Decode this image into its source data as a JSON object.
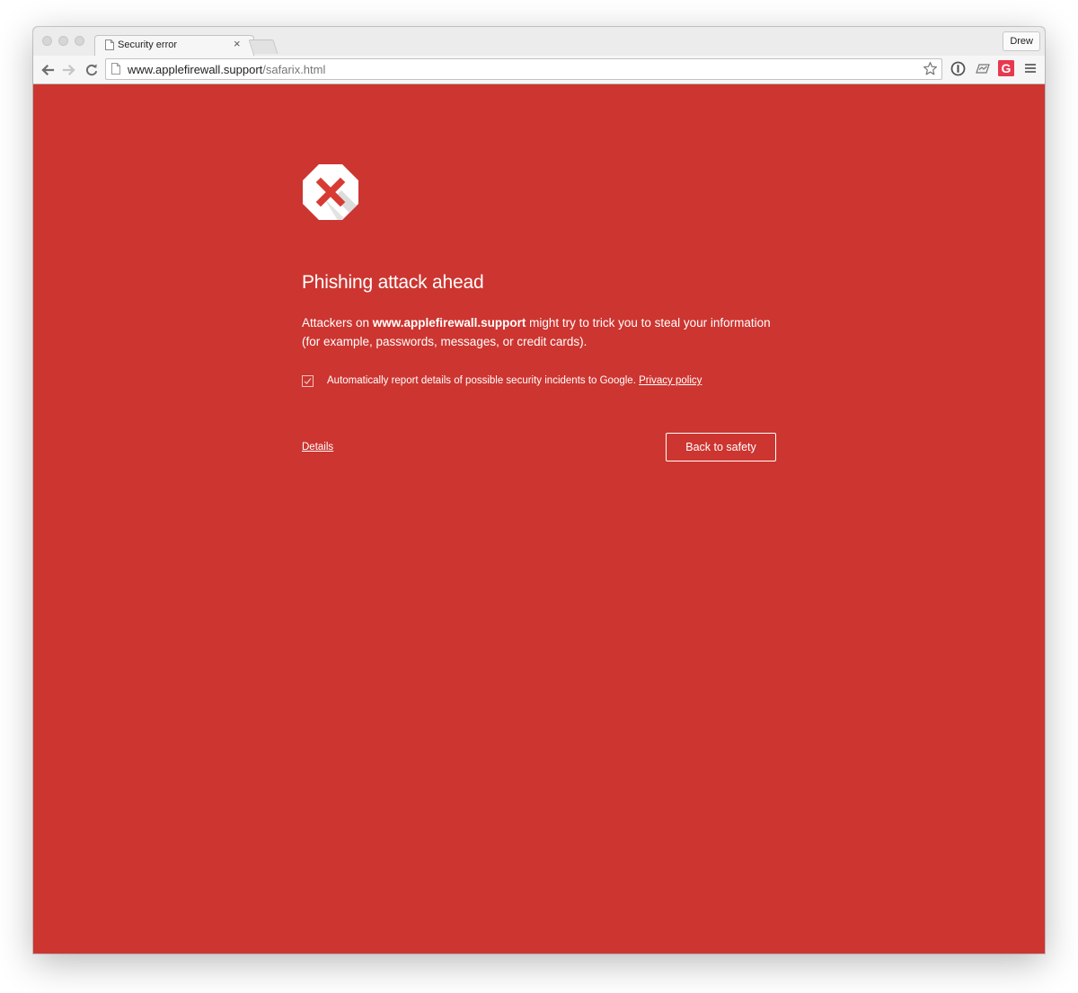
{
  "browser": {
    "tab_title": "Security error",
    "tab_close": "×",
    "profile_name": "Drew",
    "url_host": "www.applefirewall.support",
    "url_path": "/safarix.html"
  },
  "icons": {
    "back": "arrow-left-icon",
    "forward": "arrow-right-icon",
    "reload": "reload-icon",
    "bookmark": "star-icon",
    "extensions": [
      "onepassword-icon",
      "cloud-extension-icon",
      "grammarly-icon"
    ],
    "menu": "hamburger-menu-icon",
    "warning": "red-x-octagon-icon"
  },
  "page": {
    "heading": "Phishing attack ahead",
    "explanation_prefix": "Attackers on ",
    "explanation_host": "www.applefirewall.support",
    "explanation_suffix": " might try to trick you to steal your information (for example, passwords, messages, or credit cards).",
    "report_checkbox_label": "Automatically report details of possible security incidents to Google. ",
    "report_checkbox_checked": true,
    "privacy_link": "Privacy policy",
    "details_link": "Details",
    "back_button": "Back to safety"
  },
  "colors": {
    "interstitial_background": "#cd3530",
    "grammarly_brand": "#e8384f"
  }
}
